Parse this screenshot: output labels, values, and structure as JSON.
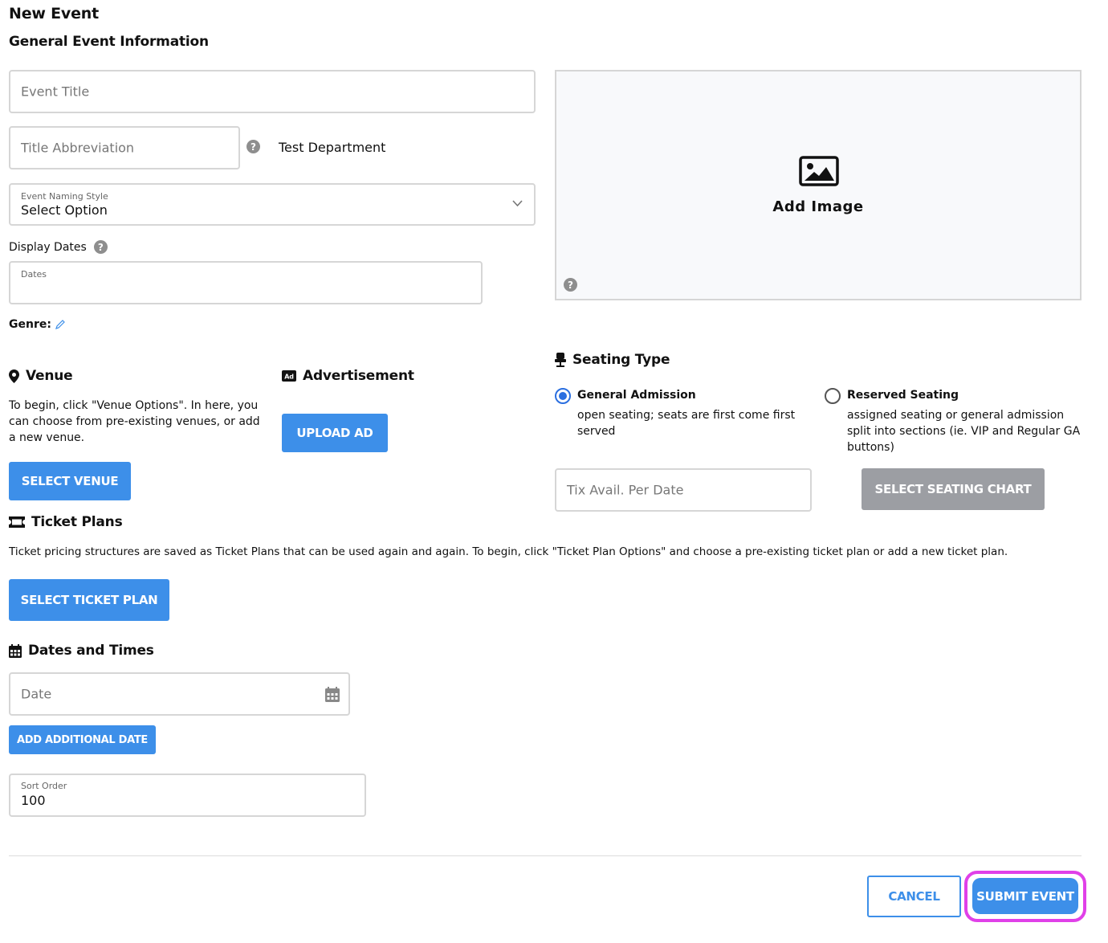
{
  "page": {
    "title": "New Event",
    "section_title": "General Event Information"
  },
  "form": {
    "event_title_placeholder": "Event Title",
    "title_abbreviation_placeholder": "Title Abbreviation",
    "department": "Test Department",
    "naming_style_label": "Event Naming Style",
    "naming_style_value": "Select Option",
    "display_dates_label": "Display Dates",
    "dates_label": "Dates",
    "genre_label": "Genre:"
  },
  "image": {
    "add_label": "Add Image"
  },
  "venue": {
    "title": "Venue",
    "description": "To begin, click \"Venue Options\". In here, you can choose from pre-existing venues, or add a new venue.",
    "button": "SELECT VENUE"
  },
  "advertisement": {
    "title": "Advertisement",
    "button": "UPLOAD AD"
  },
  "seating": {
    "title": "Seating Type",
    "options": [
      {
        "label": "General Admission",
        "description": "open seating; seats are first come first served",
        "selected": true
      },
      {
        "label": "Reserved Seating",
        "description": "assigned seating or general admission split into sections (ie. VIP and Regular GA buttons)",
        "selected": false
      }
    ],
    "tix_placeholder": "Tix Avail. Per Date",
    "chart_button": "SELECT SEATING CHART"
  },
  "ticket_plans": {
    "title": "Ticket Plans",
    "description": "Ticket pricing structures are saved as Ticket Plans that can be used again and again. To begin, click \"Ticket Plan Options\" and choose a pre-existing ticket plan or add a new ticket plan.",
    "button": "SELECT TICKET PLAN"
  },
  "dates_times": {
    "title": "Dates and Times",
    "date_placeholder": "Date",
    "add_button": "ADD ADDITIONAL DATE",
    "sort_order_label": "Sort Order",
    "sort_order_value": "100"
  },
  "footer": {
    "cancel": "CANCEL",
    "submit": "SUBMIT EVENT"
  },
  "colors": {
    "primary": "#3d8fe9",
    "disabled": "#9c9ea3",
    "highlight": "#e040e8"
  }
}
